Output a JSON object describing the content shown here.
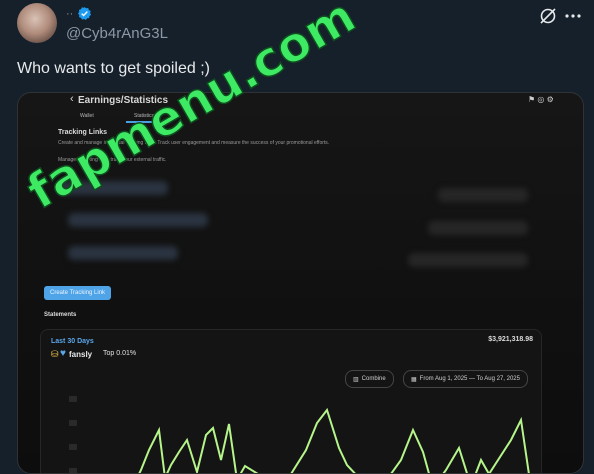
{
  "post": {
    "author_name": "··",
    "handle": "@Cyb4rAnG3L",
    "text": "Who wants to get spoiled ;)"
  },
  "screenshot": {
    "back_glyph": "‹",
    "page_title": "Earnings/Statistics",
    "tabs": [
      "Wallet",
      "Statistics"
    ],
    "section_title": "Tracking Links",
    "section_desc": "Create and manage individual tracking links. Track user engagement and measure the success of your promotional efforts.",
    "section_desc2": "Managed tracking links track your external traffic.",
    "create_button": "Create Tracking Link",
    "statements_label": "Statements",
    "period_label": "Last 30 Days",
    "amount": "$3,921,318.98",
    "brand": "fansly",
    "rank": "Top 0.01%",
    "combine_label": "Combine",
    "date_range": "From Aug 1, 2025 — To Aug 27, 2025"
  },
  "watermark": {
    "text": "fapmenu.com"
  },
  "colors": {
    "accent": "#1d9bf0",
    "chart_line": "#b6f58a",
    "watermark": "#3eea63"
  },
  "icons": {
    "verified": "verified-badge-icon",
    "mute": "no-signal-icon",
    "more": "more-dots-icon"
  }
}
